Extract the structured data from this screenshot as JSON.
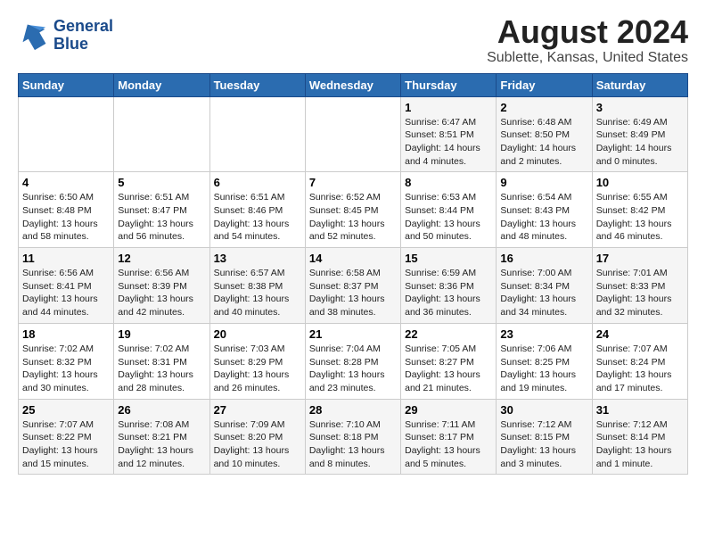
{
  "logo": {
    "line1": "General",
    "line2": "Blue"
  },
  "title": "August 2024",
  "subtitle": "Sublette, Kansas, United States",
  "days_of_week": [
    "Sunday",
    "Monday",
    "Tuesday",
    "Wednesday",
    "Thursday",
    "Friday",
    "Saturday"
  ],
  "weeks": [
    [
      {
        "day": "",
        "info": ""
      },
      {
        "day": "",
        "info": ""
      },
      {
        "day": "",
        "info": ""
      },
      {
        "day": "",
        "info": ""
      },
      {
        "day": "1",
        "info": "Sunrise: 6:47 AM\nSunset: 8:51 PM\nDaylight: 14 hours\nand 4 minutes."
      },
      {
        "day": "2",
        "info": "Sunrise: 6:48 AM\nSunset: 8:50 PM\nDaylight: 14 hours\nand 2 minutes."
      },
      {
        "day": "3",
        "info": "Sunrise: 6:49 AM\nSunset: 8:49 PM\nDaylight: 14 hours\nand 0 minutes."
      }
    ],
    [
      {
        "day": "4",
        "info": "Sunrise: 6:50 AM\nSunset: 8:48 PM\nDaylight: 13 hours\nand 58 minutes."
      },
      {
        "day": "5",
        "info": "Sunrise: 6:51 AM\nSunset: 8:47 PM\nDaylight: 13 hours\nand 56 minutes."
      },
      {
        "day": "6",
        "info": "Sunrise: 6:51 AM\nSunset: 8:46 PM\nDaylight: 13 hours\nand 54 minutes."
      },
      {
        "day": "7",
        "info": "Sunrise: 6:52 AM\nSunset: 8:45 PM\nDaylight: 13 hours\nand 52 minutes."
      },
      {
        "day": "8",
        "info": "Sunrise: 6:53 AM\nSunset: 8:44 PM\nDaylight: 13 hours\nand 50 minutes."
      },
      {
        "day": "9",
        "info": "Sunrise: 6:54 AM\nSunset: 8:43 PM\nDaylight: 13 hours\nand 48 minutes."
      },
      {
        "day": "10",
        "info": "Sunrise: 6:55 AM\nSunset: 8:42 PM\nDaylight: 13 hours\nand 46 minutes."
      }
    ],
    [
      {
        "day": "11",
        "info": "Sunrise: 6:56 AM\nSunset: 8:41 PM\nDaylight: 13 hours\nand 44 minutes."
      },
      {
        "day": "12",
        "info": "Sunrise: 6:56 AM\nSunset: 8:39 PM\nDaylight: 13 hours\nand 42 minutes."
      },
      {
        "day": "13",
        "info": "Sunrise: 6:57 AM\nSunset: 8:38 PM\nDaylight: 13 hours\nand 40 minutes."
      },
      {
        "day": "14",
        "info": "Sunrise: 6:58 AM\nSunset: 8:37 PM\nDaylight: 13 hours\nand 38 minutes."
      },
      {
        "day": "15",
        "info": "Sunrise: 6:59 AM\nSunset: 8:36 PM\nDaylight: 13 hours\nand 36 minutes."
      },
      {
        "day": "16",
        "info": "Sunrise: 7:00 AM\nSunset: 8:34 PM\nDaylight: 13 hours\nand 34 minutes."
      },
      {
        "day": "17",
        "info": "Sunrise: 7:01 AM\nSunset: 8:33 PM\nDaylight: 13 hours\nand 32 minutes."
      }
    ],
    [
      {
        "day": "18",
        "info": "Sunrise: 7:02 AM\nSunset: 8:32 PM\nDaylight: 13 hours\nand 30 minutes."
      },
      {
        "day": "19",
        "info": "Sunrise: 7:02 AM\nSunset: 8:31 PM\nDaylight: 13 hours\nand 28 minutes."
      },
      {
        "day": "20",
        "info": "Sunrise: 7:03 AM\nSunset: 8:29 PM\nDaylight: 13 hours\nand 26 minutes."
      },
      {
        "day": "21",
        "info": "Sunrise: 7:04 AM\nSunset: 8:28 PM\nDaylight: 13 hours\nand 23 minutes."
      },
      {
        "day": "22",
        "info": "Sunrise: 7:05 AM\nSunset: 8:27 PM\nDaylight: 13 hours\nand 21 minutes."
      },
      {
        "day": "23",
        "info": "Sunrise: 7:06 AM\nSunset: 8:25 PM\nDaylight: 13 hours\nand 19 minutes."
      },
      {
        "day": "24",
        "info": "Sunrise: 7:07 AM\nSunset: 8:24 PM\nDaylight: 13 hours\nand 17 minutes."
      }
    ],
    [
      {
        "day": "25",
        "info": "Sunrise: 7:07 AM\nSunset: 8:22 PM\nDaylight: 13 hours\nand 15 minutes."
      },
      {
        "day": "26",
        "info": "Sunrise: 7:08 AM\nSunset: 8:21 PM\nDaylight: 13 hours\nand 12 minutes."
      },
      {
        "day": "27",
        "info": "Sunrise: 7:09 AM\nSunset: 8:20 PM\nDaylight: 13 hours\nand 10 minutes."
      },
      {
        "day": "28",
        "info": "Sunrise: 7:10 AM\nSunset: 8:18 PM\nDaylight: 13 hours\nand 8 minutes."
      },
      {
        "day": "29",
        "info": "Sunrise: 7:11 AM\nSunset: 8:17 PM\nDaylight: 13 hours\nand 5 minutes."
      },
      {
        "day": "30",
        "info": "Sunrise: 7:12 AM\nSunset: 8:15 PM\nDaylight: 13 hours\nand 3 minutes."
      },
      {
        "day": "31",
        "info": "Sunrise: 7:12 AM\nSunset: 8:14 PM\nDaylight: 13 hours\nand 1 minute."
      }
    ]
  ]
}
